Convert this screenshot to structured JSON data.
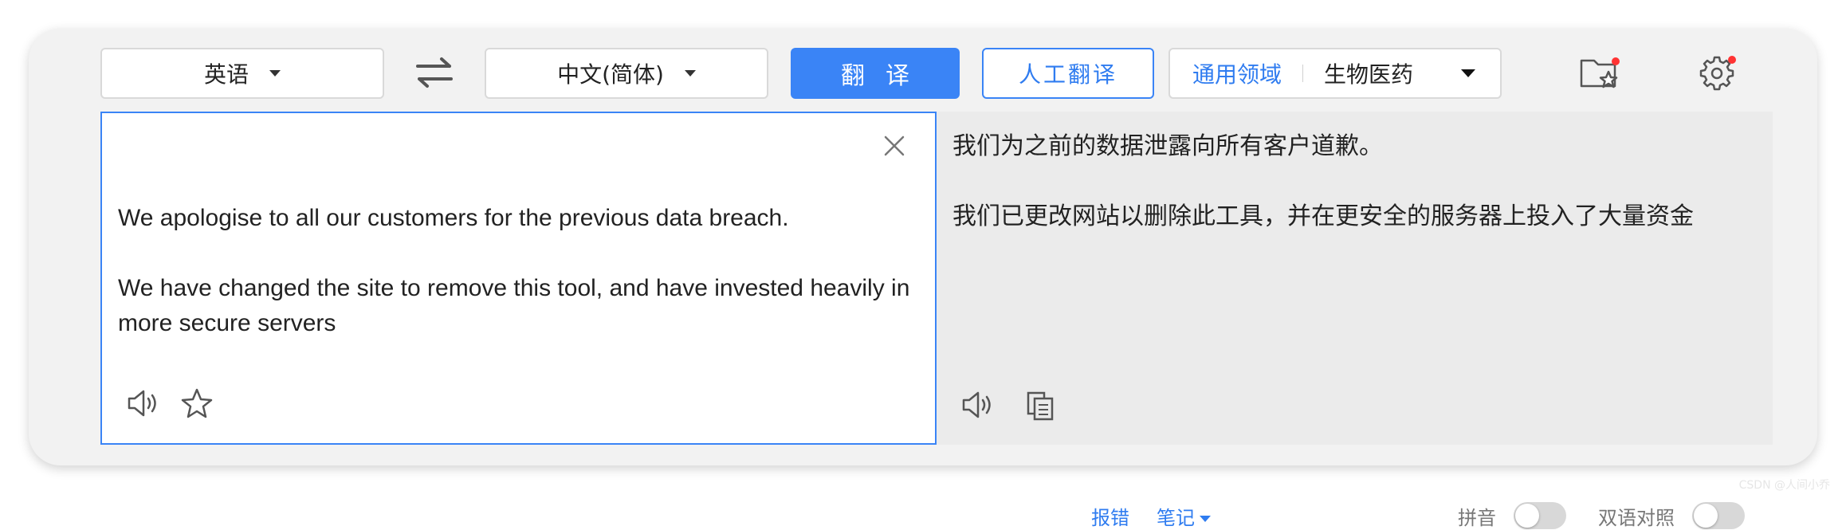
{
  "toolbar": {
    "source_lang": "英语",
    "target_lang": "中文(简体)",
    "translate_label": "翻译",
    "human_translate_label": "人工翻译",
    "domain_general": "通用领域",
    "domain_specialty": "生物医药"
  },
  "source": {
    "paragraphs": [
      "We apologise to all our customers for the previous data breach.",
      "We have changed the site to remove this tool, and have invested heavily in more secure servers"
    ]
  },
  "target": {
    "paragraphs": [
      "我们为之前的数据泄露向所有客户道歉。",
      "我们已更改网站以删除此工具，并在更安全的服务器上投入了大量资金"
    ],
    "report_error_label": "报错",
    "notes_label": "笔记",
    "pinyin_label": "拼音",
    "bilingual_label": "双语对照",
    "pinyin_on": false,
    "bilingual_on": false
  },
  "watermark": "CSDN @人间小乔"
}
